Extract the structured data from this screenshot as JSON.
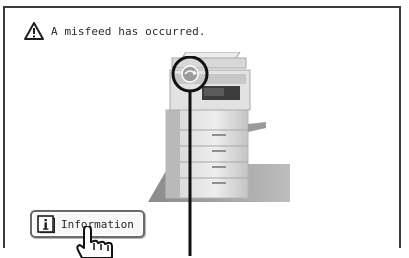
{
  "alert": {
    "icon": "warning-triangle-icon",
    "message": "A misfeed has occurred."
  },
  "illustration": {
    "name": "copier-illustration",
    "callout_icon": "jam-location-marker-icon"
  },
  "info_button": {
    "label": "Information",
    "icon": "info-icon"
  },
  "pointer": {
    "icon": "hand-pointer-icon"
  },
  "colors": {
    "border": "#3a3a3a",
    "text": "#2b2b2b",
    "button_border": "#6a6a6a"
  }
}
